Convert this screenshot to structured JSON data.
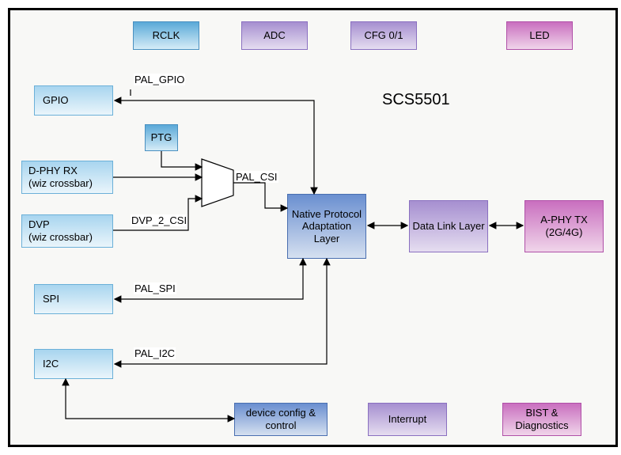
{
  "title": "SCS5501",
  "blocks": {
    "rclk": "RCLK",
    "adc": "ADC",
    "cfg": "CFG 0/1",
    "led": "LED",
    "gpio": "GPIO",
    "ptg": "PTG",
    "dphy": "D-PHY RX\n(wiz crossbar)",
    "dvp": "DVP\n(wiz crossbar)",
    "spi": "SPI",
    "i2c": "I2C",
    "npal": "Native Protocol Adaptation Layer",
    "dll": "Data Link Layer",
    "aphy": "A-PHY TX (2G/4G)",
    "devcfg": "device config & control",
    "interrupt": "Interrupt",
    "bist": "BIST & Diagnostics"
  },
  "labels": {
    "pal_gpio": "PAL_GPIO",
    "pal_csi": "PAL_CSI",
    "dvp_2_csi": "DVP_2_CSI",
    "pal_spi": "PAL_SPI",
    "pal_i2c": "PAL_I2C"
  }
}
